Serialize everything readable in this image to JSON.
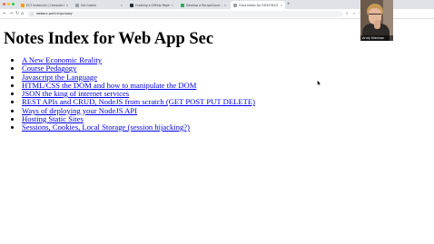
{
  "browser": {
    "tabs": [
      {
        "label": "EC2 Instances | Compute E...",
        "favicon_color": "#ff9900",
        "active": false
      },
      {
        "label": "Set Cookie",
        "favicon_color": "#9aa0a6",
        "active": false
      },
      {
        "label": "Creating a GitHub Pages s...",
        "favicon_color": "#24292f",
        "active": false
      },
      {
        "label": "Develop a RecipeCloud - trans...",
        "favicon_color": "#34a853",
        "active": false
      },
      {
        "label": "Class Notes for CSIS4762/2...",
        "favicon_color": "#9aa0a6",
        "active": true
      }
    ],
    "new_tab_glyph": "+",
    "window_dot_colors": [
      "#ff5f57",
      "#febc2e",
      "#28c840"
    ],
    "nav": {
      "back": "←",
      "forward": "→",
      "reload": "↻",
      "home": "⌂"
    },
    "url": "webacc.pmf.nlnpcnowy",
    "toolbar_icons": {
      "search": "⌕",
      "bookmark": "☆",
      "menu": "⋮"
    }
  },
  "page": {
    "title": "Notes Index for Web App Sec",
    "links": [
      "A New Economic Reality",
      "Course Pedagogy",
      "Javascript the Language",
      "HTML/CSS the DOM and how to manipulate the DOM",
      "JSON the king of internet services",
      "REST APIs and CRUD, NodeJS from scratch (GET POST PUT DELETE)",
      "Ways of deploying your NodeJS API",
      "Hosting Static Sites",
      "Sessions, Cookies, Local Storage (session hijacking?)"
    ],
    "link_color": "#0000ee"
  },
  "webcam": {
    "name": "Andy Nieshan"
  }
}
